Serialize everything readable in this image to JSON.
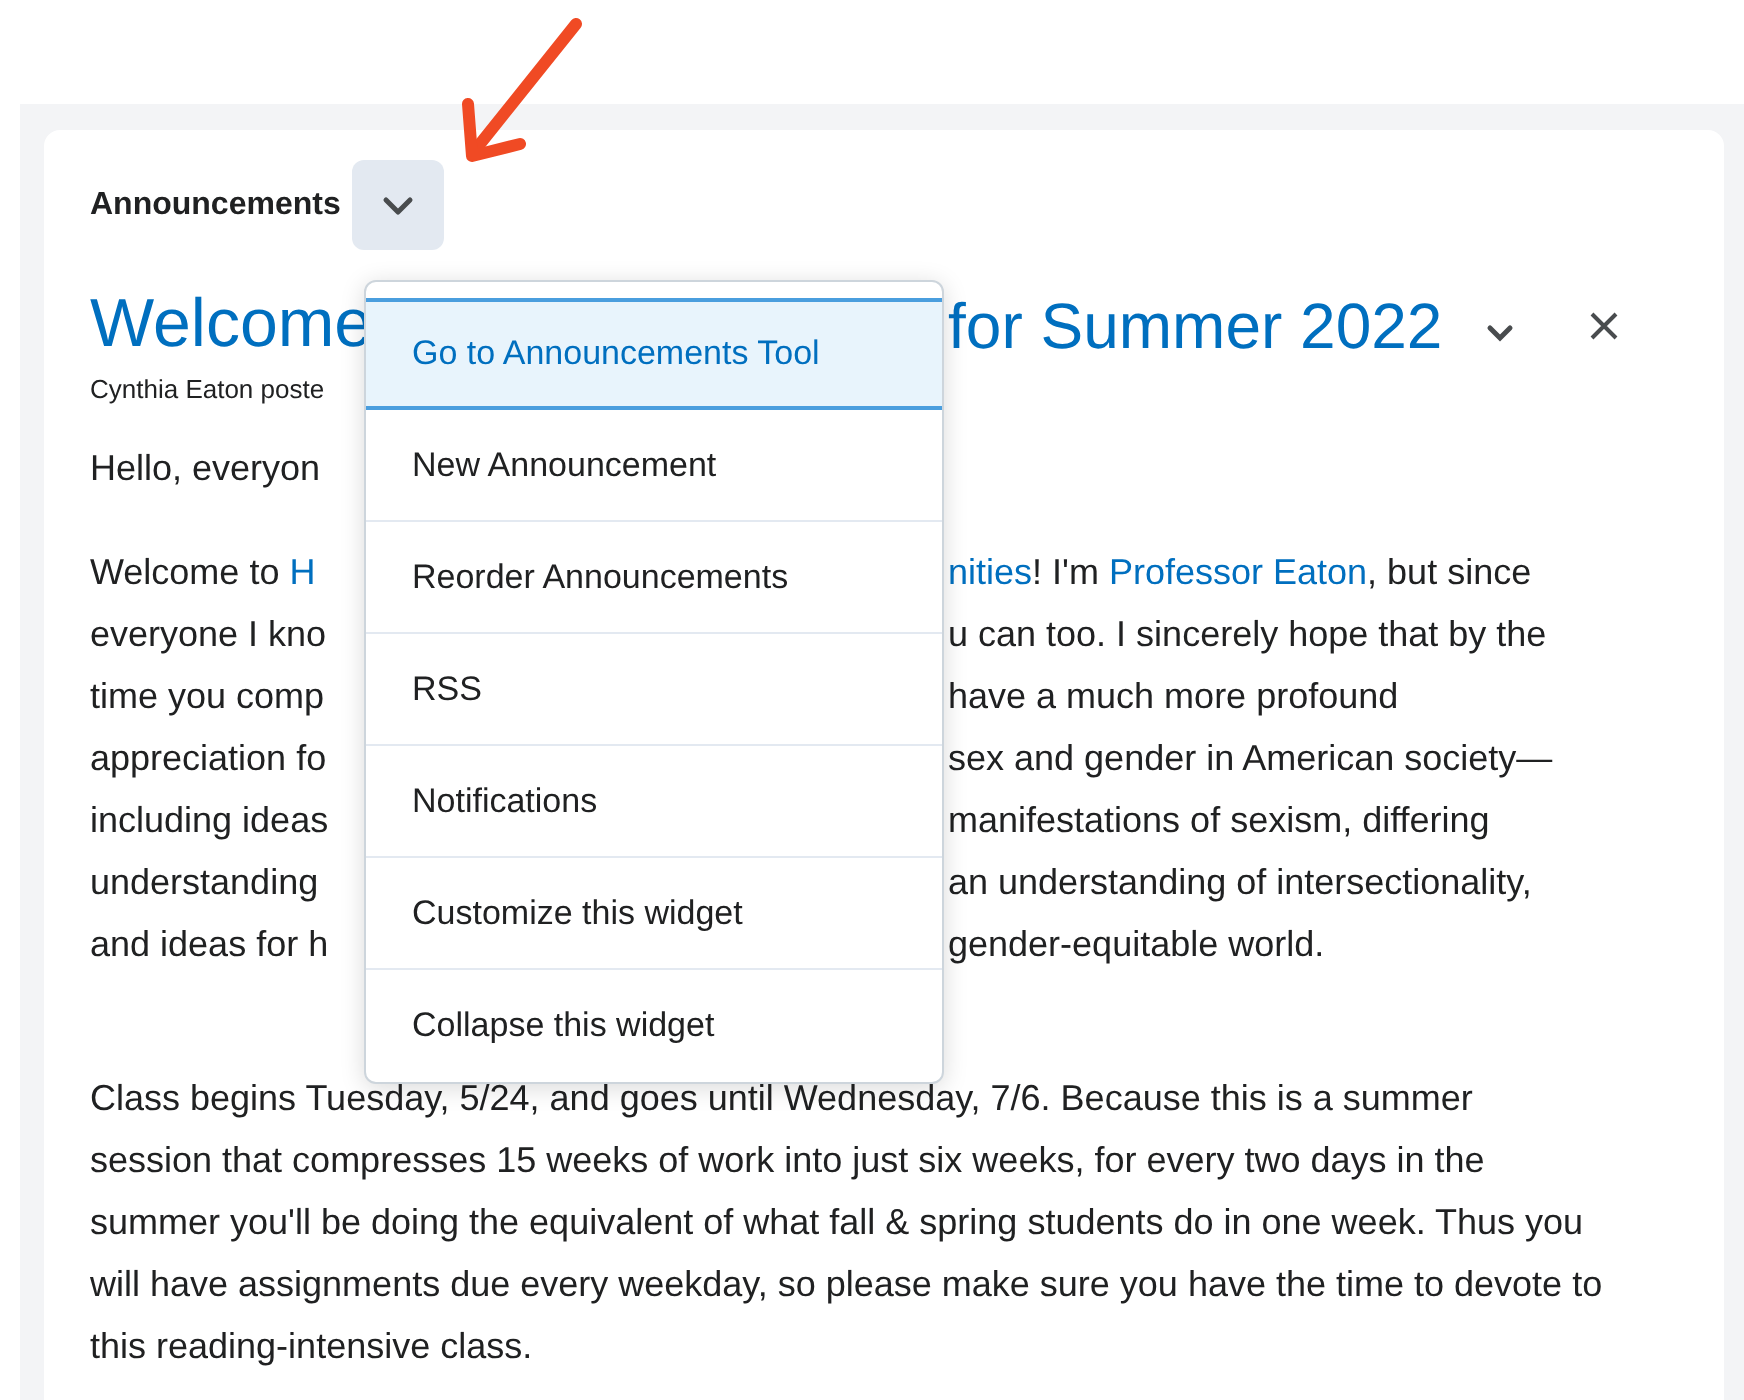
{
  "widget": {
    "title": "Announcements",
    "menu_open": true
  },
  "menu": [
    {
      "label": "Go to Announcements Tool",
      "selected": true
    },
    {
      "label": "New Announcement",
      "selected": false
    },
    {
      "label": "Reorder Announcements",
      "selected": false
    },
    {
      "label": "RSS",
      "selected": false
    },
    {
      "label": "Notifications",
      "selected": false
    },
    {
      "label": "Customize this widget",
      "selected": false
    },
    {
      "label": "Collapse this widget",
      "selected": false
    }
  ],
  "announcement": {
    "title_left": "Welcome",
    "title_right": "for Summer 2022",
    "author": "Cynthia Eaton poste",
    "greeting": "Hello, everyon",
    "lines": [
      {
        "left": [
          {
            "text": "Welcome to ",
            "link": false
          },
          {
            "text": "H",
            "link": true
          }
        ],
        "right": [
          {
            "text": "nities",
            "link": true
          },
          {
            "text": "! I'm ",
            "link": false
          },
          {
            "text": "Professor Eaton",
            "link": true
          },
          {
            "text": ", but since",
            "link": false
          }
        ]
      },
      {
        "left": [
          {
            "text": "everyone I kno",
            "link": false
          }
        ],
        "right": [
          {
            "text": "u can too. I sincerely hope that by the",
            "link": false
          }
        ]
      },
      {
        "left": [
          {
            "text": "time you comp",
            "link": false
          }
        ],
        "right": [
          {
            "text": "have a much more profound",
            "link": false
          }
        ]
      },
      {
        "left": [
          {
            "text": "appreciation fo",
            "link": false
          }
        ],
        "right": [
          {
            "text": "sex and gender in American society—",
            "link": false
          }
        ]
      },
      {
        "left": [
          {
            "text": "including ideas",
            "link": false
          }
        ],
        "right": [
          {
            "text": "manifestations of sexism, differing",
            "link": false
          }
        ]
      },
      {
        "left": [
          {
            "text": "understanding",
            "link": false
          }
        ],
        "right": [
          {
            "text": "an understanding of intersectionality,",
            "link": false
          }
        ]
      },
      {
        "left": [
          {
            "text": "and ideas for h",
            "link": false
          }
        ],
        "right": [
          {
            "text": "gender-equitable world.",
            "link": false
          }
        ]
      }
    ],
    "paragraph": "Class begins Tuesday, 5/24, and goes until Wednesday, 7/6. Because this is a summer session that compresses 15 weeks of work into just six weeks, for every two days in the summer you'll be doing the equivalent of what fall & spring students do in one week. Thus you will have assignments due every weekday, so please make sure you have the time to devote to this reading-intensive class."
  }
}
